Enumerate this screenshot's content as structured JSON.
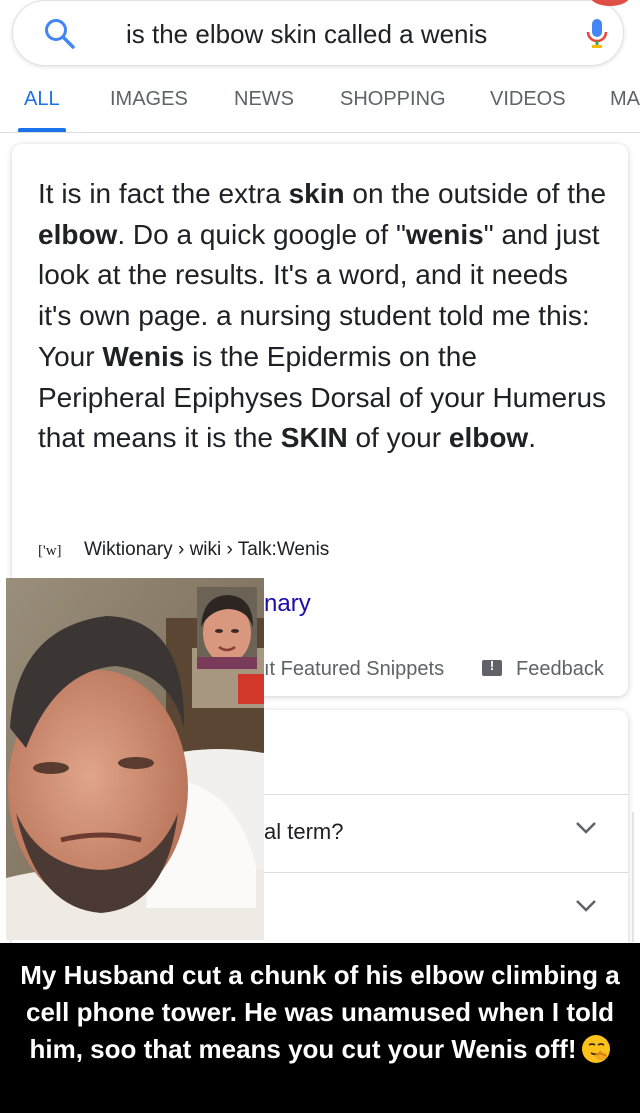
{
  "search": {
    "query": "is the elbow skin called a wenis",
    "search_icon": "search-icon",
    "mic_icon": "microphone-icon"
  },
  "tabs": [
    {
      "label": "ALL",
      "active": true
    },
    {
      "label": "IMAGES",
      "active": false
    },
    {
      "label": "NEWS",
      "active": false
    },
    {
      "label": "SHOPPING",
      "active": false
    },
    {
      "label": "VIDEOS",
      "active": false
    },
    {
      "label": "MA",
      "active": false
    }
  ],
  "snippet": {
    "segments": [
      {
        "text": "It is in fact the extra ",
        "bold": false
      },
      {
        "text": "skin",
        "bold": true
      },
      {
        "text": " on the outside of the ",
        "bold": false
      },
      {
        "text": "elbow",
        "bold": true
      },
      {
        "text": ". Do a quick google of \"",
        "bold": false
      },
      {
        "text": "wenis",
        "bold": true
      },
      {
        "text": "\" and just look at the results. It's a word, and it needs it's own page. a nursing student told me this: Your ",
        "bold": false
      },
      {
        "text": "Wenis",
        "bold": true
      },
      {
        "text": " is the Epidermis on the Peripheral Epiphyses Dorsal of your Humerus that means it is the ",
        "bold": false
      },
      {
        "text": "SKIN",
        "bold": true
      },
      {
        "text": " of your ",
        "bold": false
      },
      {
        "text": "elbow",
        "bold": true
      },
      {
        "text": ".",
        "bold": false
      }
    ],
    "favicon": "['w]",
    "breadcrumb": "Wiktionary › wiki › Talk:Wenis",
    "source_title": "nary",
    "about_label": "ıt Featured Snippets",
    "feedback_label": "Feedback",
    "feedback_icon": "feedback-icon"
  },
  "people_also_ask": [
    {
      "question": "",
      "chevron": "chevron-down-icon"
    },
    {
      "question": "al term?",
      "chevron": "chevron-down-icon"
    },
    {
      "question": "",
      "chevron": "chevron-down-icon"
    }
  ],
  "caption": {
    "text": "My Husband cut a chunk of his elbow climbing a cell phone tower. He was unamused when I told him, soo that means you cut your Wenis off!",
    "emoji": "smirking-face-emoji"
  },
  "colors": {
    "accent": "#1a73e8",
    "link": "#1a0dab",
    "caption_bg": "#000000"
  }
}
